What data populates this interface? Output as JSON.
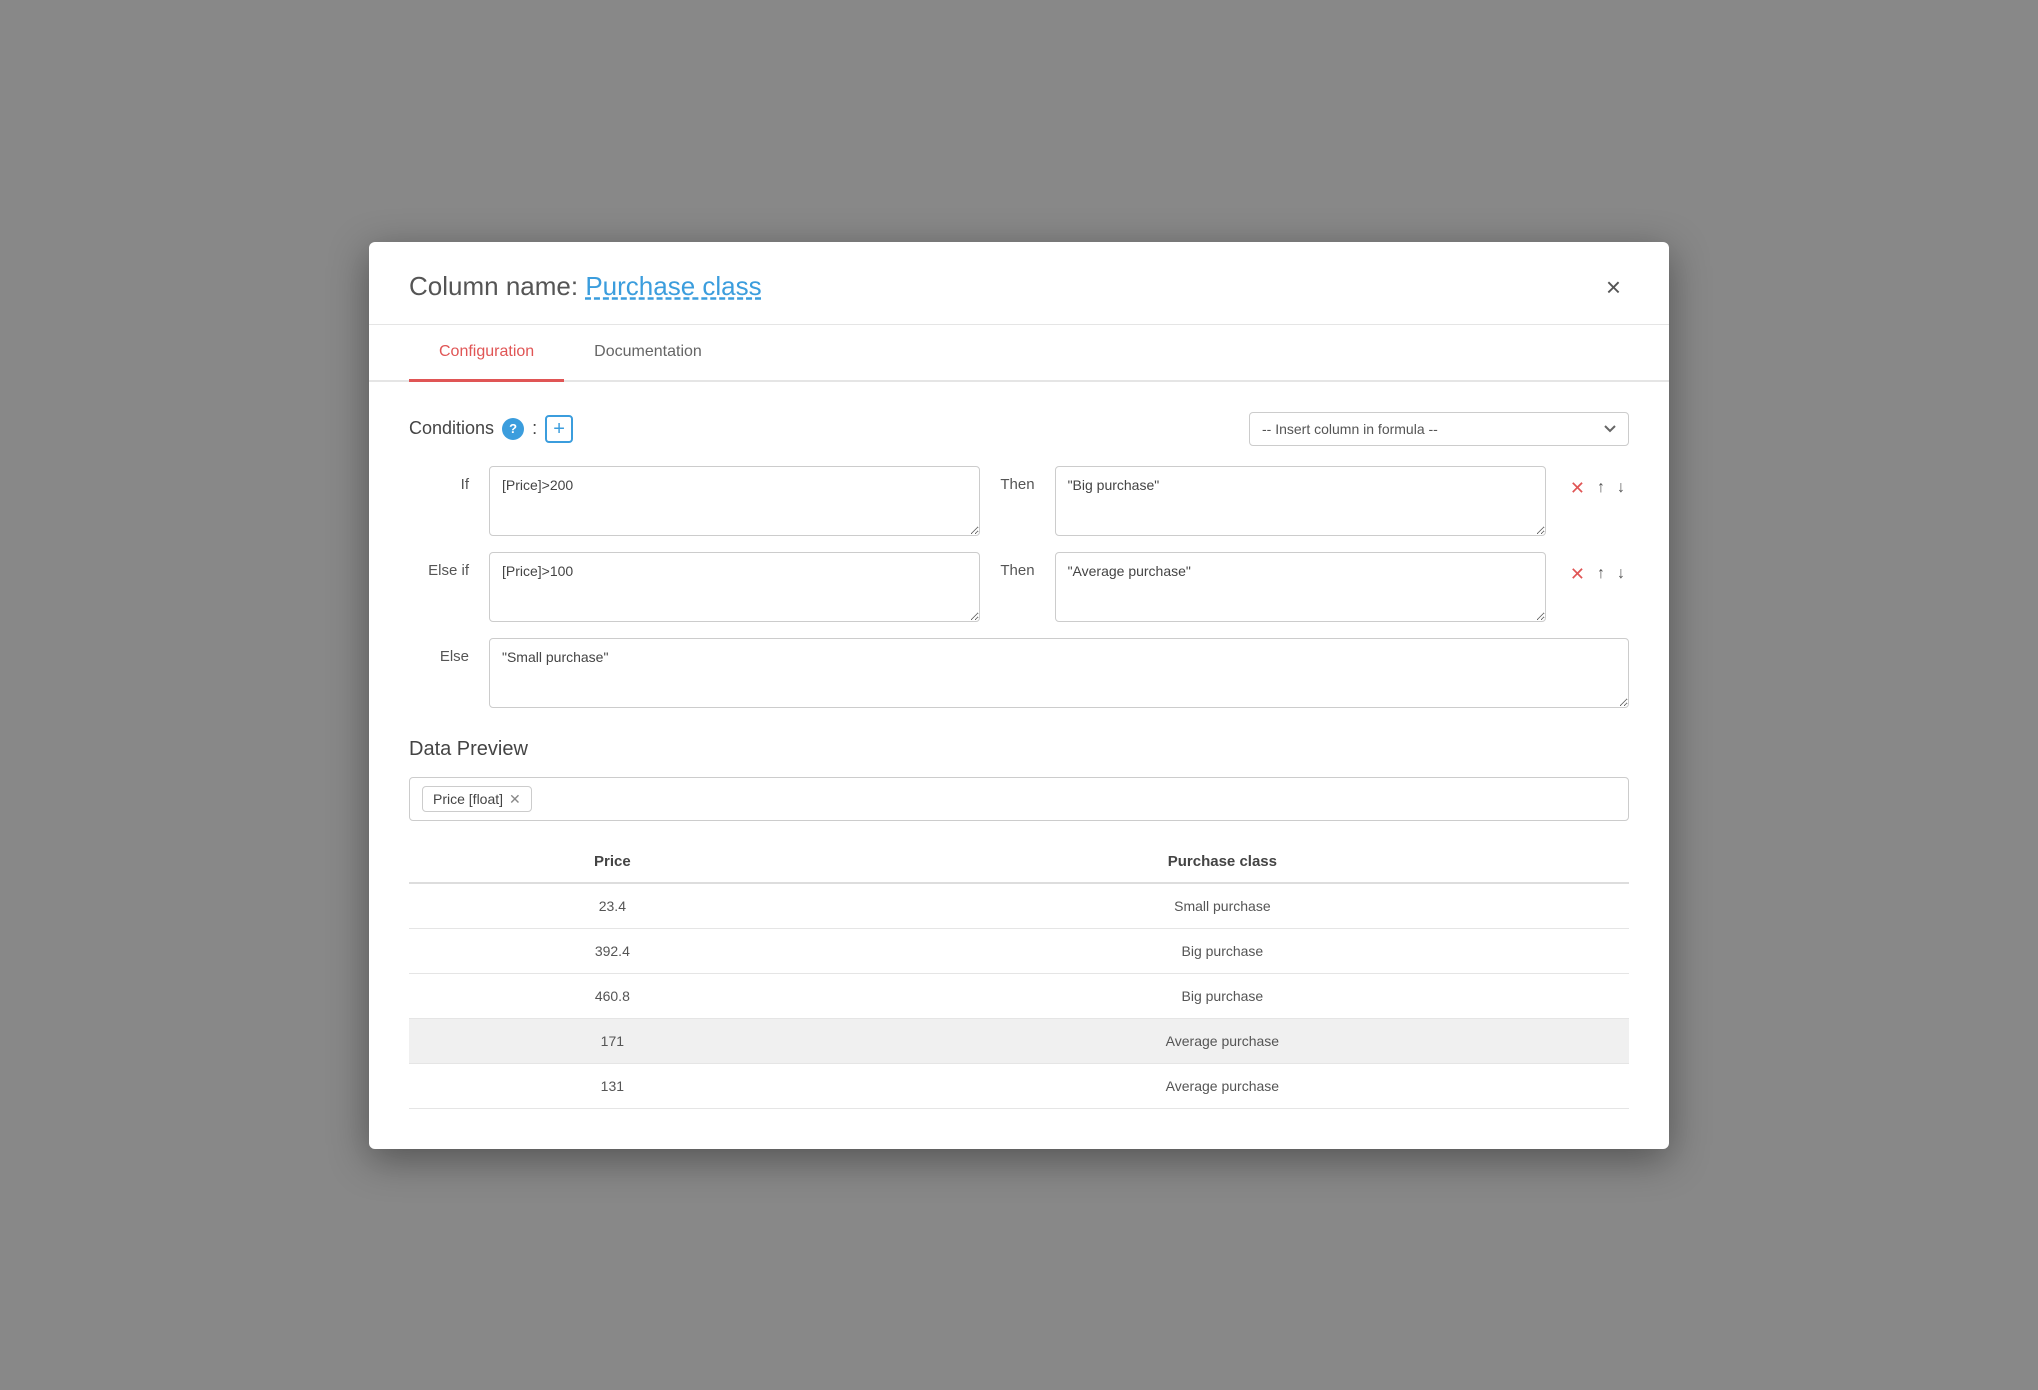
{
  "modal": {
    "title_prefix": "Column name: ",
    "title_link": "Purchase class",
    "close_label": "×"
  },
  "tabs": [
    {
      "id": "configuration",
      "label": "Configuration",
      "active": true
    },
    {
      "id": "documentation",
      "label": "Documentation",
      "active": false
    }
  ],
  "conditions": {
    "label": "Conditions",
    "help_icon": "?",
    "add_btn_label": "+",
    "insert_placeholder": "-- Insert column in formula --",
    "rows": [
      {
        "row_label": "If",
        "condition_value": "[Price]>200",
        "then_label": "Then",
        "then_value": "\"Big purchase\""
      },
      {
        "row_label": "Else if",
        "condition_value": "[Price]>100",
        "then_label": "Then",
        "then_value": "\"Average purchase\""
      }
    ],
    "else": {
      "label": "Else",
      "value": "\"Small purchase\""
    }
  },
  "data_preview": {
    "title": "Data Preview",
    "filter_tag": "Price [float]",
    "columns": [
      "Price",
      "Purchase class"
    ],
    "rows": [
      {
        "price": "23.4",
        "purchase_class": "Small purchase",
        "highlighted": false
      },
      {
        "price": "392.4",
        "purchase_class": "Big purchase",
        "highlighted": false
      },
      {
        "price": "460.8",
        "purchase_class": "Big purchase",
        "highlighted": false
      },
      {
        "price": "171",
        "purchase_class": "Average purchase",
        "highlighted": true
      },
      {
        "price": "131",
        "purchase_class": "Average purchase",
        "highlighted": false
      }
    ]
  },
  "icons": {
    "close": "✕",
    "delete": "✕",
    "up": "↑",
    "down": "↓",
    "remove_tag": "✕"
  }
}
